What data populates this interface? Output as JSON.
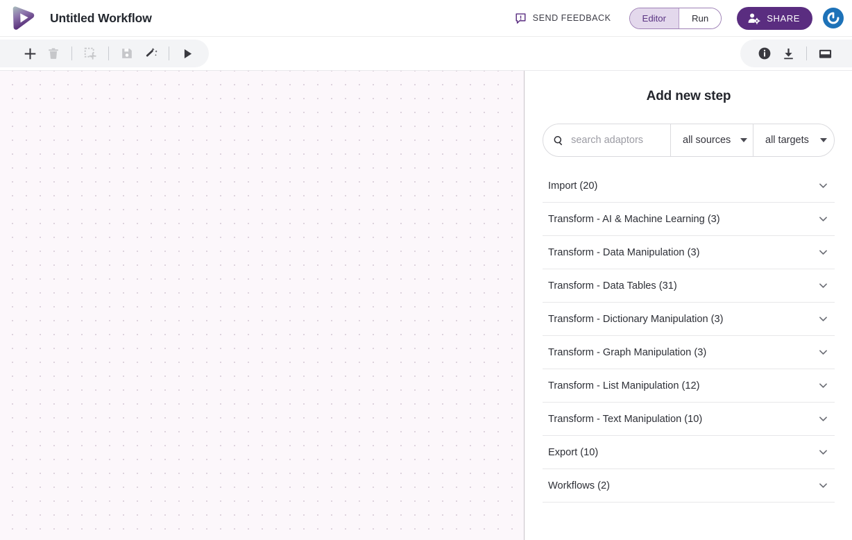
{
  "header": {
    "logo_icon": "openfn-play-logo-icon",
    "title": "Untitled Workflow",
    "feedback": {
      "icon": "feedback-bubble-icon",
      "label": "SEND FEEDBACK"
    },
    "mode_toggle": {
      "options": [
        {
          "label": "Editor",
          "active": true
        },
        {
          "label": "Run",
          "active": false
        }
      ]
    },
    "share": {
      "icon": "person-gear-icon",
      "label": "SHARE"
    },
    "avatar_icon": "user-avatar-icon",
    "colors": {
      "share_bg": "#5a2d80",
      "toggle_active_bg": "#e3d8ec",
      "toggle_active_text": "#5a3483",
      "toggle_border": "#9d7fb5",
      "avatar_bg": "#1d72b8"
    }
  },
  "toolbar": {
    "left_tools": [
      {
        "name": "add-step-button",
        "icon": "plus-icon",
        "enabled": true
      },
      {
        "name": "delete-button",
        "icon": "trash-icon",
        "enabled": false
      },
      {
        "name": "divider-1",
        "icon": "divider",
        "enabled": false
      },
      {
        "name": "select-area-button",
        "icon": "dashed-box-plus-icon",
        "enabled": false
      },
      {
        "name": "divider-2",
        "icon": "divider",
        "enabled": false
      },
      {
        "name": "save-button",
        "icon": "floppy-save-icon",
        "enabled": false
      },
      {
        "name": "auto-layout-button",
        "icon": "magic-wand-icon",
        "enabled": true
      },
      {
        "name": "divider-3",
        "icon": "divider",
        "enabled": false
      },
      {
        "name": "run-button",
        "icon": "play-icon",
        "enabled": true
      }
    ],
    "right_tools": [
      {
        "name": "info-button",
        "icon": "info-circle-icon",
        "enabled": true
      },
      {
        "name": "download-button",
        "icon": "download-icon",
        "enabled": true
      },
      {
        "name": "divider-4",
        "icon": "divider",
        "enabled": false
      },
      {
        "name": "toggle-panel-button",
        "icon": "panel-layout-icon",
        "enabled": true
      }
    ]
  },
  "canvas": {
    "background_color": "#fcf7fb",
    "dot_color": "#ddd2dd",
    "dot_spacing_px": 20
  },
  "panel": {
    "title": "Add new step",
    "search": {
      "icon": "search-icon",
      "placeholder": "search adaptors",
      "value": ""
    },
    "filters": [
      {
        "name": "sources-select",
        "label": "all sources",
        "icon": "chevron-down-icon"
      },
      {
        "name": "targets-select",
        "label": "all targets",
        "icon": "chevron-down-icon"
      }
    ],
    "categories": [
      {
        "label": "Import (20)",
        "expanded": false
      },
      {
        "label": "Transform - AI & Machine Learning (3)",
        "expanded": false
      },
      {
        "label": "Transform - Data Manipulation (3)",
        "expanded": false
      },
      {
        "label": "Transform - Data Tables (31)",
        "expanded": false
      },
      {
        "label": "Transform - Dictionary Manipulation (3)",
        "expanded": false
      },
      {
        "label": "Transform - Graph Manipulation (3)",
        "expanded": false
      },
      {
        "label": "Transform - List Manipulation (12)",
        "expanded": false
      },
      {
        "label": "Transform - Text Manipulation (10)",
        "expanded": false
      },
      {
        "label": "Export (10)",
        "expanded": false
      },
      {
        "label": "Workflows (2)",
        "expanded": false
      }
    ]
  }
}
